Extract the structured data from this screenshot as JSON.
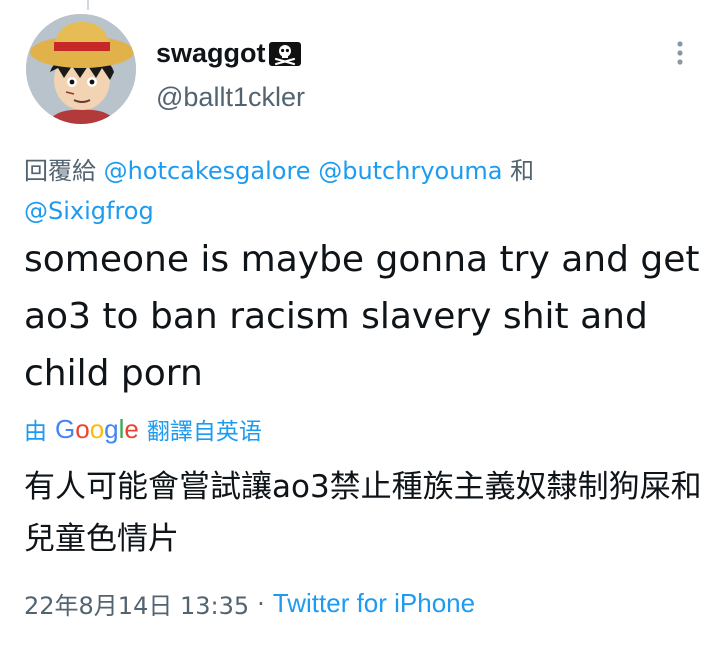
{
  "user": {
    "display_name": "swaggot",
    "name_emoji": "skull-and-crossbones-flag",
    "handle": "@ballt1ckler"
  },
  "reply": {
    "prefix": "回覆給",
    "mentions": [
      "@hotcakesgalore",
      "@butchryouma",
      "@Sixigfrog"
    ],
    "conjunction": "和"
  },
  "tweet": {
    "text": "someone is maybe gonna try and get ao3 to ban racism slavery shit and child porn"
  },
  "translation": {
    "by_label": "由",
    "provider": "Google",
    "from_label": "翻譯自英语",
    "text": "有人可能會嘗試讓ao3禁止種族主義奴隸制狗屎和兒童色情片"
  },
  "meta": {
    "date": "22年8月14日 13:35",
    "separator": "·",
    "source": "Twitter for iPhone"
  },
  "colors": {
    "link": "#1d9bf0",
    "secondary_text": "#536471",
    "primary_text": "#0f1419"
  },
  "icons": {
    "more": "more-vertical-icon",
    "avatar": "avatar-straw-hat-character"
  }
}
